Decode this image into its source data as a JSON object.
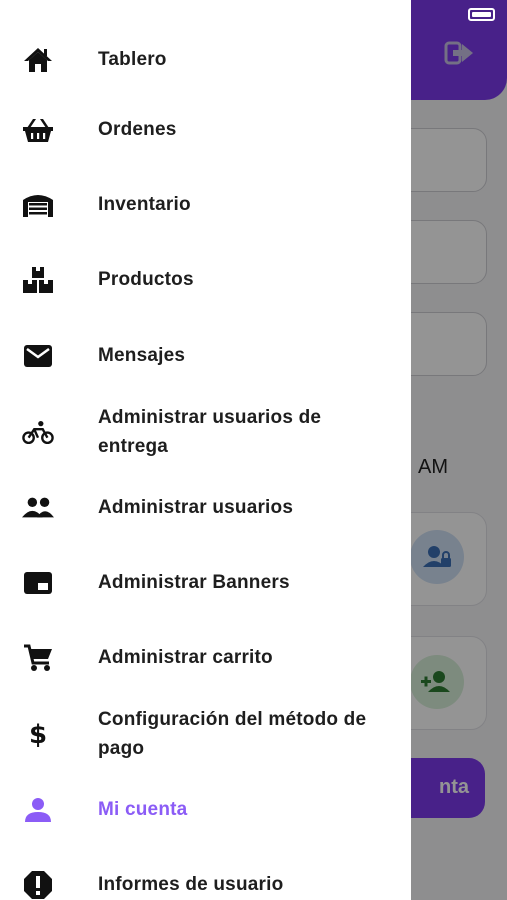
{
  "drawer": {
    "items": [
      {
        "label": "Tablero",
        "icon": "home-icon"
      },
      {
        "label": "Ordenes",
        "icon": "basket-icon"
      },
      {
        "label": "Inventario",
        "icon": "warehouse-icon"
      },
      {
        "label": "Productos",
        "icon": "boxes-icon"
      },
      {
        "label": "Mensajes",
        "icon": "mail-icon"
      },
      {
        "label": "Administrar usuarios de entrega",
        "icon": "bike-icon"
      },
      {
        "label": "Administrar usuarios",
        "icon": "people-icon"
      },
      {
        "label": "Administrar Banners",
        "icon": "banner-icon"
      },
      {
        "label": "Administrar carrito",
        "icon": "cart-icon"
      },
      {
        "label": "Configuración del método de pago",
        "icon": "dollar-icon"
      },
      {
        "label": "Mi cuenta",
        "icon": "person-icon",
        "active": true
      },
      {
        "label": "Informes de usuario",
        "icon": "alert-icon"
      }
    ],
    "active_color": "#8b5cf6",
    "text_color": "#1e1e1e"
  },
  "background": {
    "header_color": "#7c3aed",
    "time_suffix": "AM",
    "button_label": "nta",
    "logout_icon": "logout-icon",
    "card_icons": [
      "user-lock-icon",
      "add-user-icon"
    ]
  }
}
